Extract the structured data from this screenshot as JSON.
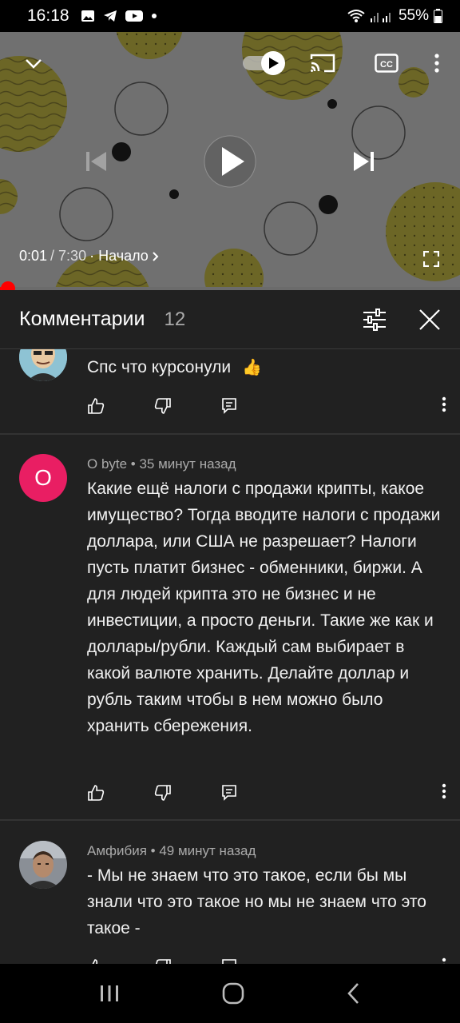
{
  "status_bar": {
    "time": "16:18",
    "battery": "55%",
    "icons": [
      "gallery-icon",
      "telegram-icon",
      "youtube-icon",
      "dot-icon",
      "wifi-icon",
      "signal-icon",
      "battery-icon"
    ]
  },
  "player": {
    "current_time": "0:01",
    "total_time": "/ 7:30",
    "chapter": "· Начало",
    "progress": 0.002,
    "icons": [
      "chevron-down-icon",
      "autoplay-toggle-icon",
      "cast-icon",
      "captions-icon",
      "more-vert-icon",
      "previous-icon",
      "play-icon",
      "next-icon",
      "fullscreen-icon"
    ],
    "accent": "#ff0000"
  },
  "comments_panel": {
    "title": "Комментарии",
    "count": "12",
    "icons": [
      "filter-icon",
      "close-icon"
    ]
  },
  "comments": [
    {
      "author": "",
      "meta": "",
      "text": "Спс что курсонули",
      "emoji": "👍",
      "avatar_type": "cartoon"
    },
    {
      "author": "O byte",
      "meta": "O byte • 35 минут назад",
      "avatar_letter": "O",
      "avatar_color": "#e91e63",
      "text": "Какие ещё налоги с продажи крипты, какое имущество? Тогда вводите налоги с продажи доллара, или США не разрешает? Налоги пусть платит бизнес - обменники, биржи. А для людей крипта это не бизнес и не инвестиции, а просто деньги. Такие же как и доллары/рубли. Каждый сам выбирает в какой валюте хранить. Делайте доллар и рубль таким чтобы в нем можно было хранить сбережения."
    },
    {
      "author": "Амфибия",
      "meta": "Амфибия • 49 минут назад",
      "avatar_type": "photo",
      "text": "- Мы не знаем что это такое, если бы мы знали что это такое но мы не знаем что это такое -"
    }
  ],
  "comment_action_icons": [
    "like-icon",
    "dislike-icon",
    "reply-icon",
    "more-vert-icon"
  ],
  "navbar": {
    "icons": [
      "recents-icon",
      "home-icon",
      "back-icon"
    ]
  }
}
